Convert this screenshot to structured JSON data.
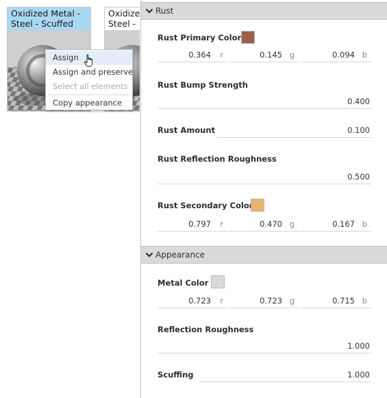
{
  "thumbnails": [
    {
      "title": "Oxidized Metal -\nSteel - Scuffed",
      "selected": true
    },
    {
      "title": "Oxidize\nSteel -",
      "selected": false
    }
  ],
  "context_menu": {
    "items": [
      {
        "label": "Assign",
        "state": "hover"
      },
      {
        "label": "Assign and preserve",
        "state": "normal"
      },
      {
        "label": "Select all elements",
        "state": "disabled"
      },
      {
        "label": "Copy appearance",
        "state": "normal"
      }
    ]
  },
  "sections": {
    "rust": {
      "title": "Rust",
      "primary_color": {
        "label": "Rust Primary Color",
        "swatch": "#a05f4a",
        "r": "0.364",
        "g": "0.145",
        "b": "0.094"
      },
      "bump_strength": {
        "label": "Rust Bump Strength",
        "value": "0.400"
      },
      "amount": {
        "label": "Rust Amount",
        "value": "0.100"
      },
      "reflection_roughness": {
        "label": "Rust Reflection Roughness",
        "value": "0.500"
      },
      "secondary_color": {
        "label": "Rust Secondary Color",
        "swatch": "#e6b46c",
        "r": "0.797",
        "g": "0.470",
        "b": "0.167"
      }
    },
    "appearance": {
      "title": "Appearance",
      "metal_color": {
        "label": "Metal Color",
        "swatch": "#dadada",
        "r": "0.723",
        "g": "0.723",
        "b": "0.715"
      },
      "reflection_roughness": {
        "label": "Reflection Roughness",
        "value": "1.000"
      },
      "scuffing": {
        "label": "Scuffing",
        "value": "1.000"
      }
    }
  },
  "units": {
    "r": "r",
    "g": "g",
    "b": "b"
  },
  "icons": {
    "section_toggle": "chevron-down-icon",
    "cursor": "hand-pointer-icon"
  }
}
